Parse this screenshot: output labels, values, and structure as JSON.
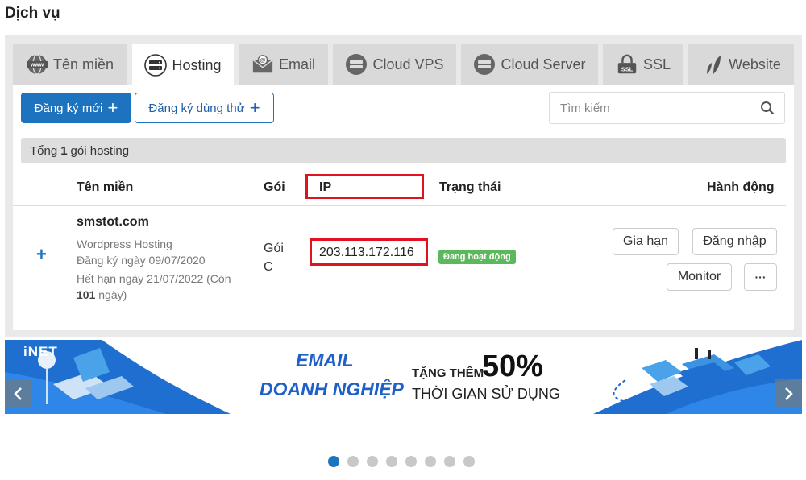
{
  "page": {
    "title": "Dịch vụ"
  },
  "tabs": [
    {
      "label": "Tên miền",
      "icon": "globe-www-icon",
      "active": false
    },
    {
      "label": "Hosting",
      "icon": "server-hosting-icon",
      "active": true
    },
    {
      "label": "Email",
      "icon": "email-envelope-icon",
      "active": false
    },
    {
      "label": "Cloud VPS",
      "icon": "cloud-server-icon",
      "active": false
    },
    {
      "label": "Cloud Server",
      "icon": "cloud-server-icon",
      "active": false
    },
    {
      "label": "SSL",
      "icon": "ssl-lock-icon",
      "active": false
    },
    {
      "label": "Website",
      "icon": "website-leaf-icon",
      "active": false
    }
  ],
  "toolbar": {
    "register_new": "Đăng ký mới",
    "register_trial": "Đăng ký dùng thử",
    "search_placeholder": "Tìm kiếm"
  },
  "summary": {
    "prefix": "Tổng",
    "count": "1",
    "suffix": "gói hosting"
  },
  "table": {
    "headers": {
      "domain": "Tên miền",
      "package": "Gói",
      "ip": "IP",
      "status": "Trạng thái",
      "actions": "Hành động"
    },
    "rows": [
      {
        "domain": "smstot.com",
        "type": "Wordpress Hosting",
        "registered": "Đăng ký ngày 09/07/2020",
        "expires_prefix": "Hết hạn ngày 21/07/2022 (Còn",
        "days_left": "101",
        "days_suffix": "ngày)",
        "package_line1": "Gói",
        "package_line2": "C",
        "ip": "203.113.172.116",
        "status": "Đang hoạt động",
        "actions": {
          "renew": "Gia hạn",
          "login": "Đăng nhập",
          "monitor": "Monitor",
          "more": "···"
        }
      }
    ]
  },
  "banner": {
    "logo": "iNET",
    "headline_line1": "EMAIL",
    "headline_line2": "DOANH NGHIỆP",
    "promo_prefix": "TẶNG THÊM",
    "promo_value": "50%",
    "promo_line2": "THỜI GIAN SỬ DỤNG"
  },
  "carousel": {
    "total": 8,
    "active_index": 0
  },
  "colors": {
    "primary": "#1e73be",
    "success": "#5cb85c",
    "highlight": "#e0121f",
    "banner_blue": "#1f6fd1"
  }
}
